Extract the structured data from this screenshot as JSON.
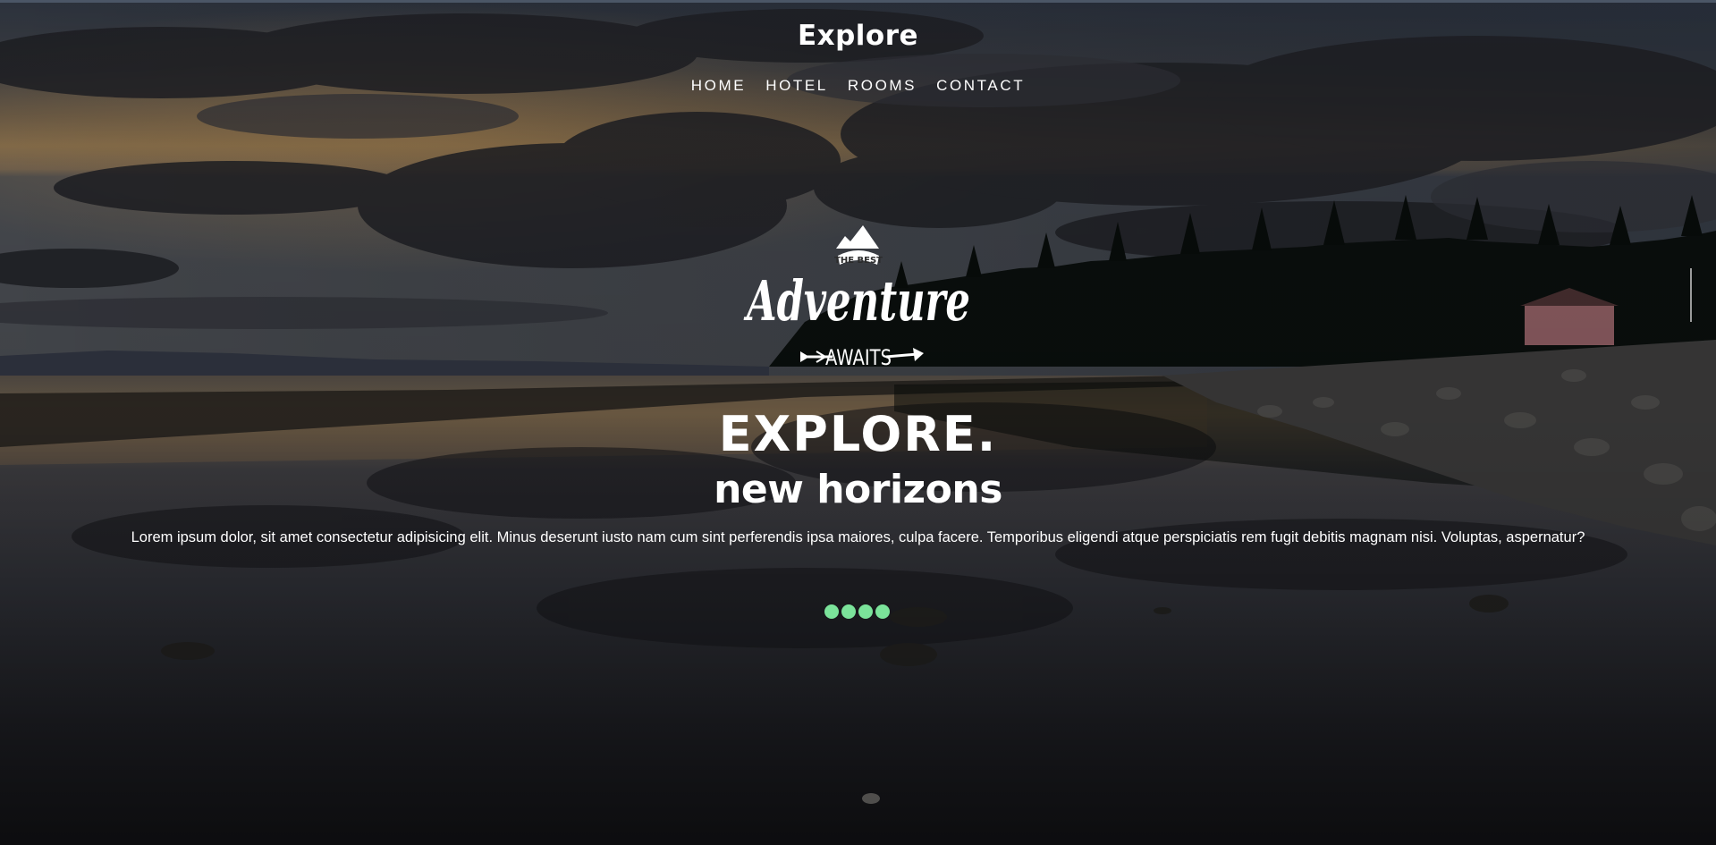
{
  "header": {
    "brand": "Explore"
  },
  "nav": {
    "items": [
      "HOME",
      "HOTEL",
      "ROOMS",
      "CONTACT"
    ]
  },
  "logo": {
    "line1": "THE BEST",
    "line2": "Adventure",
    "line3": "AWAITS"
  },
  "hero": {
    "headline": "EXPLORE.",
    "subheadline": "new horizons",
    "blurb": "Lorem ipsum dolor, sit amet consectetur adipisicing elit. Minus deserunt iusto nam cum sint perferendis ipsa maiores, culpa facere. Temporibus eligendi atque perspiciatis rem fugit debitis magnam nisi. Voluptas, aspernatur?"
  },
  "slider": {
    "dot_count": 4,
    "active_color": "#7be39a"
  },
  "colors": {
    "text": "#ffffff",
    "accent": "#7be39a"
  }
}
